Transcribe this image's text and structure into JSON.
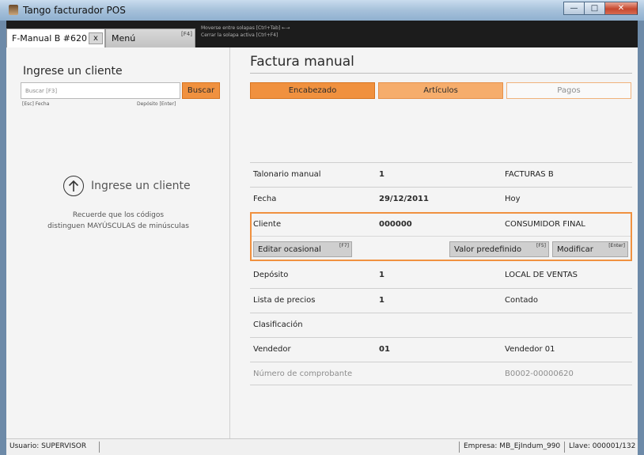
{
  "window": {
    "title": "Tango facturador POS",
    "controls": {
      "minimize": "—",
      "maximize": "□",
      "close": "✕"
    }
  },
  "tabs": {
    "active": {
      "label": "F-Manual B #620",
      "close": "x"
    },
    "menu": {
      "label": "Menú",
      "key": "[F4]"
    },
    "hints": [
      "Moverse entre solapas [Ctrl+Tab] ←→",
      "Cerrar la solapa activa [Ctrl+F4]"
    ]
  },
  "left_panel": {
    "title": "Ingrese un cliente",
    "search_placeholder": "Buscar [F3]",
    "search_button": "Buscar",
    "hint_left": "[Esc] Fecha",
    "hint_right": "Depósito [Enter]",
    "empty_state_title": "Ingrese un cliente",
    "empty_state_icon": "arrow-up-circle-icon",
    "note_line1": "Recuerde que los códigos",
    "note_line2": "distinguen MAYÚSCULAS de minúsculas"
  },
  "main": {
    "title": "Factura manual",
    "steps": [
      "Encabezado",
      "Artículos",
      "Pagos"
    ],
    "rows": {
      "talonario": {
        "label": "Talonario manual",
        "value": "1",
        "desc": "FACTURAS B"
      },
      "fecha": {
        "label": "Fecha",
        "value": "29/12/2011",
        "desc": "Hoy"
      },
      "cliente": {
        "label": "Cliente",
        "value": "000000",
        "desc": "CONSUMIDOR FINAL"
      },
      "deposito": {
        "label": "Depósito",
        "value": "1",
        "desc": "LOCAL DE VENTAS"
      },
      "lista": {
        "label": "Lista de precios",
        "value": "1",
        "desc": "Contado"
      },
      "clasificacion": {
        "label": "Clasificación",
        "value": "",
        "desc": ""
      },
      "vendedor": {
        "label": "Vendedor",
        "value": "01",
        "desc": "Vendedor 01"
      },
      "numero": {
        "label": "Número de comprobante",
        "value": "",
        "desc": "B0002-00000620"
      }
    },
    "cliente_buttons": {
      "editar": {
        "label": "Editar ocasional",
        "key": "[F7]"
      },
      "valor": {
        "label": "Valor predefinido",
        "key": "[F5]"
      },
      "modificar": {
        "label": "Modificar",
        "key": "[Enter]"
      }
    }
  },
  "statusbar": {
    "user": "Usuario: SUPERVISOR",
    "empresa": "Empresa: MB_EjIndum_990",
    "llave": "Llave: 000001/132"
  },
  "colors": {
    "accent": "#f0913f",
    "accent_light": "#f6ad6c",
    "tab_strip": "#1c1c1c"
  }
}
